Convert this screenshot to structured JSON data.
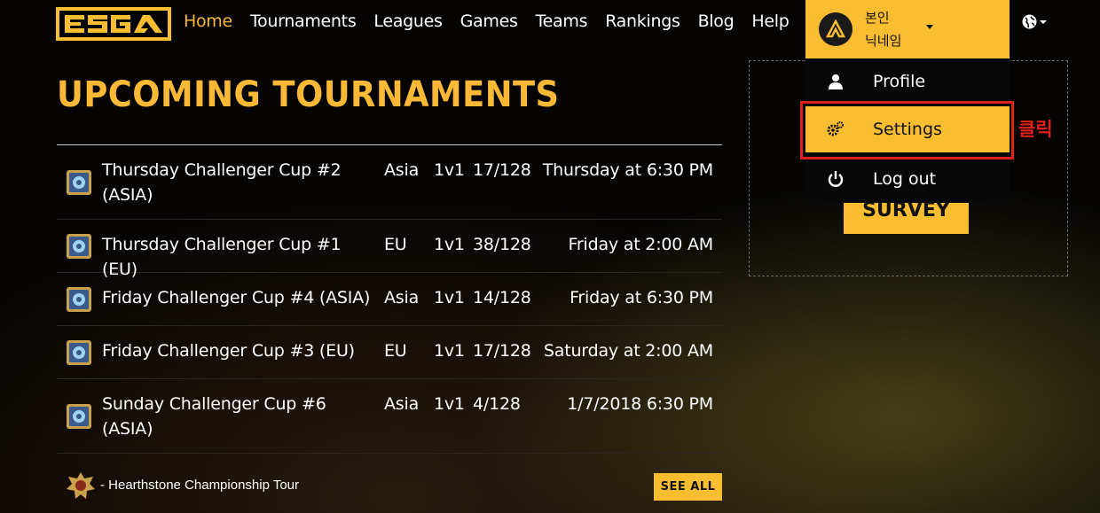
{
  "brand": {
    "logo_text": "ESGA",
    "accent": "#f9bd32"
  },
  "nav": {
    "items": [
      {
        "label": "Home",
        "active": true
      },
      {
        "label": "Tournaments"
      },
      {
        "label": "Leagues"
      },
      {
        "label": "Games"
      },
      {
        "label": "Teams"
      },
      {
        "label": "Rankings"
      },
      {
        "label": "Blog"
      },
      {
        "label": "Help"
      }
    ]
  },
  "user": {
    "name_line1": "본인",
    "name_line2": "닉네임",
    "avatar_icon": "avatar-logo-icon"
  },
  "page": {
    "title": "UPCOMING TOURNAMENTS"
  },
  "tournaments": [
    {
      "name": "Thursday Challenger Cup #2 (ASIA)",
      "region": "Asia",
      "mode": "1v1",
      "slots": "17/128",
      "date": "Thursday at 6:30 PM"
    },
    {
      "name": "Thursday Challenger Cup #1 (EU)",
      "region": "EU",
      "mode": "1v1",
      "slots": "38/128",
      "date": "Friday at 2:00 AM"
    },
    {
      "name": "Friday Challenger Cup #4 (ASIA)",
      "region": "Asia",
      "mode": "1v1",
      "slots": "14/128",
      "date": "Friday at 6:30 PM"
    },
    {
      "name": "Friday Challenger Cup #3 (EU)",
      "region": "EU",
      "mode": "1v1",
      "slots": "17/128",
      "date": "Saturday at 2:00 AM"
    },
    {
      "name": "Sunday Challenger Cup #6 (ASIA)",
      "region": "Asia",
      "mode": "1v1",
      "slots": "4/128",
      "date": "1/7/2018 6:30 PM"
    }
  ],
  "footer": {
    "series_label": "- Hearthstone Championship Tour",
    "see_all": "SEE ALL"
  },
  "side": {
    "survey_label": "SURVEY"
  },
  "dropdown": {
    "items": [
      {
        "label": "Profile",
        "icon": "user-icon"
      },
      {
        "label": "Settings",
        "icon": "gears-icon"
      },
      {
        "label": "Log out",
        "icon": "power-icon"
      }
    ]
  },
  "annotation": {
    "text": "클릭",
    "color": "#e0201a"
  }
}
